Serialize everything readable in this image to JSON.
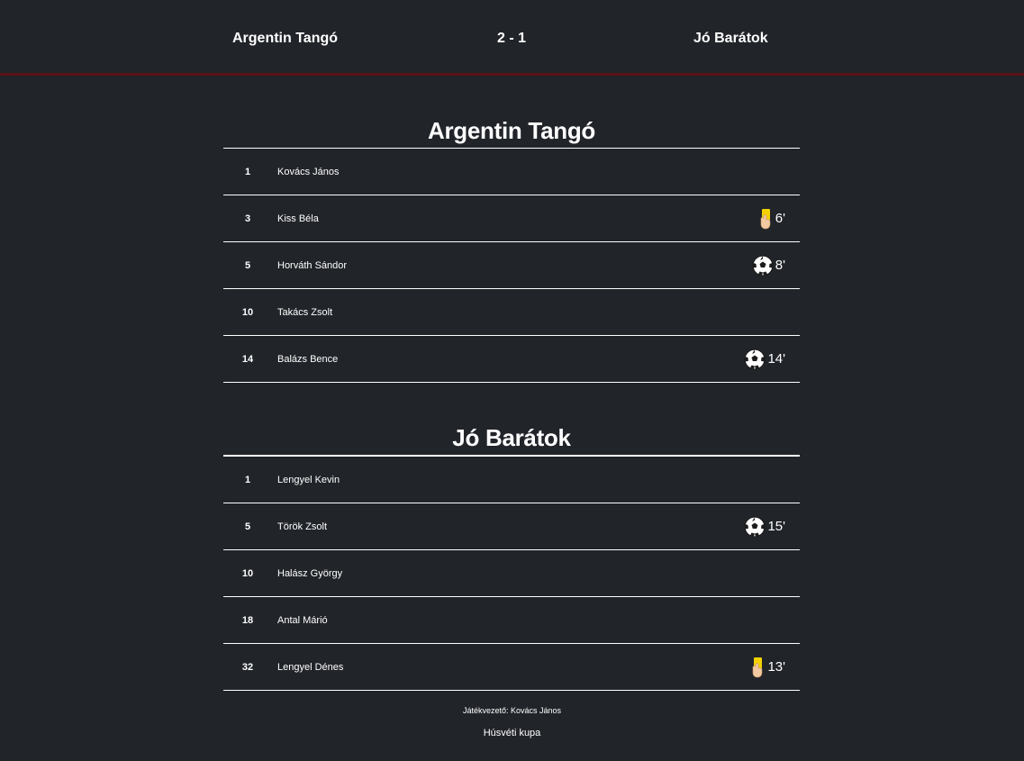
{
  "scoreboard": {
    "home_team": "Argentin Tangó",
    "score": "2 - 1",
    "away_team": "Jó Barátok"
  },
  "teams": [
    {
      "name": "Argentin Tangó",
      "players": [
        {
          "number": "1",
          "name": "Kovács János",
          "event": null,
          "minute": ""
        },
        {
          "number": "3",
          "name": "Kiss Béla",
          "event": "yellow-card-icon",
          "minute": "6'"
        },
        {
          "number": "5",
          "name": "Horváth Sándor",
          "event": "soccer-ball-icon",
          "minute": "8'"
        },
        {
          "number": "10",
          "name": "Takács Zsolt",
          "event": null,
          "minute": ""
        },
        {
          "number": "14",
          "name": "Balázs Bence",
          "event": "soccer-ball-icon",
          "minute": "14'"
        }
      ]
    },
    {
      "name": "Jó Barátok",
      "players": [
        {
          "number": "1",
          "name": "Lengyel Kevin",
          "event": null,
          "minute": ""
        },
        {
          "number": "5",
          "name": "Török Zsolt",
          "event": "soccer-ball-icon",
          "minute": "15'"
        },
        {
          "number": "10",
          "name": "Halász György",
          "event": null,
          "minute": ""
        },
        {
          "number": "18",
          "name": "Antal Márió",
          "event": null,
          "minute": ""
        },
        {
          "number": "32",
          "name": "Lengyel Dénes",
          "event": "yellow-card-icon",
          "minute": "13'"
        }
      ]
    }
  ],
  "footer": {
    "referee": "Játékvezető: Kovács János",
    "cup": "Húsvéti kupa"
  },
  "colors": {
    "background": "#212429",
    "header_rule": "#5a1218",
    "yellow_card": "#f5d000"
  }
}
